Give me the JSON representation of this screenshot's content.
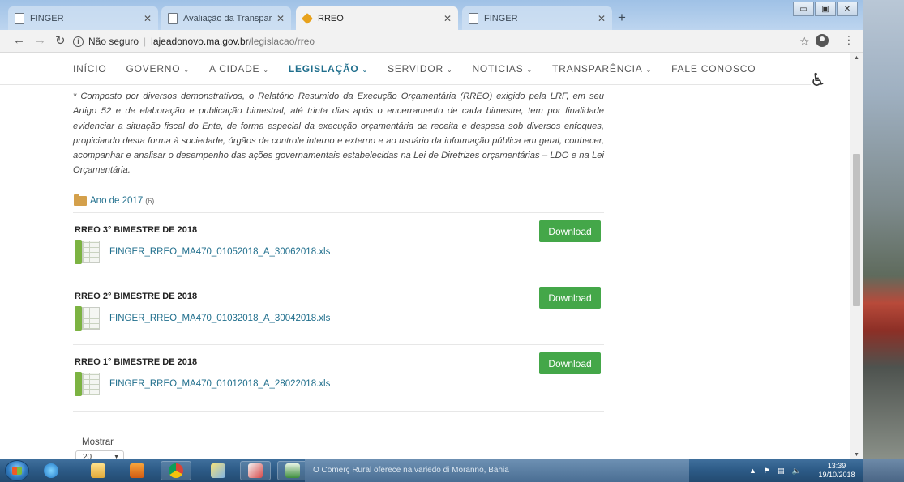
{
  "browser": {
    "tabs": [
      {
        "title": "FINGER",
        "active": false
      },
      {
        "title": "Avaliação da Transparência dos",
        "active": false
      },
      {
        "title": "RREO",
        "active": true
      },
      {
        "title": "FINGER",
        "active": false
      }
    ],
    "new_tab": "+",
    "address": {
      "security_label": "Não seguro",
      "host": "lajeadonovo.ma.gov.br",
      "path": "/legislacao/rreo"
    }
  },
  "site": {
    "nav": [
      {
        "label": "INÍCIO",
        "has_menu": false,
        "active": false
      },
      {
        "label": "GOVERNO",
        "has_menu": true,
        "active": false
      },
      {
        "label": "A CIDADE",
        "has_menu": true,
        "active": false
      },
      {
        "label": "LEGISLAÇÃO",
        "has_menu": true,
        "active": true
      },
      {
        "label": "SERVIDOR",
        "has_menu": true,
        "active": false
      },
      {
        "label": "NOTICIAS",
        "has_menu": true,
        "active": false
      },
      {
        "label": "TRANSPARÊNCIA",
        "has_menu": true,
        "active": false
      },
      {
        "label": "FALE CONOSCO",
        "has_menu": false,
        "active": false
      }
    ],
    "accessibility_glyph": "♿"
  },
  "content": {
    "intro": "* Composto por diversos demonstrativos, o Relatório Resumido da Execução Orçamentária (RREO) exigido pela LRF, em seu Artigo 52 e de elaboração e publicação bimestral, até trinta dias após o encerramento de cada bimestre, tem por finalidade evidenciar a situação fiscal do Ente, de forma especial da execução orçamentária da receita e despesa sob diversos enfoques, propiciando desta forma à sociedade, órgãos de controle interno e externo e ao usuário da informação pública em geral, conhecer, acompanhar e analisar o desempenho das ações governamentais estabelecidas na Lei de Diretrizes orçamentárias – LDO e na Lei Orçamentária.",
    "folder": {
      "label": "Ano de 2017",
      "count": "(6)"
    },
    "documents": [
      {
        "title": "RREO 3° BIMESTRE DE 2018",
        "file": "FINGER_RREO_MA470_01052018_A_30062018.xls",
        "button": "Download"
      },
      {
        "title": "RREO 2° BIMESTRE DE 2018",
        "file": "FINGER_RREO_MA470_01032018_A_30042018.xls",
        "button": "Download"
      },
      {
        "title": "RREO 1° BIMESTRE DE 2018",
        "file": "FINGER_RREO_MA470_01012018_A_28022018.xls",
        "button": "Download"
      }
    ],
    "pagination": {
      "show_label": "Mostrar",
      "per_page": "20"
    }
  },
  "taskbar": {
    "preview_text": "O Comerç Rural oferece na variedo di Moranno, Bahia",
    "clock_time": "13:39",
    "clock_date": "19/10/2018"
  }
}
